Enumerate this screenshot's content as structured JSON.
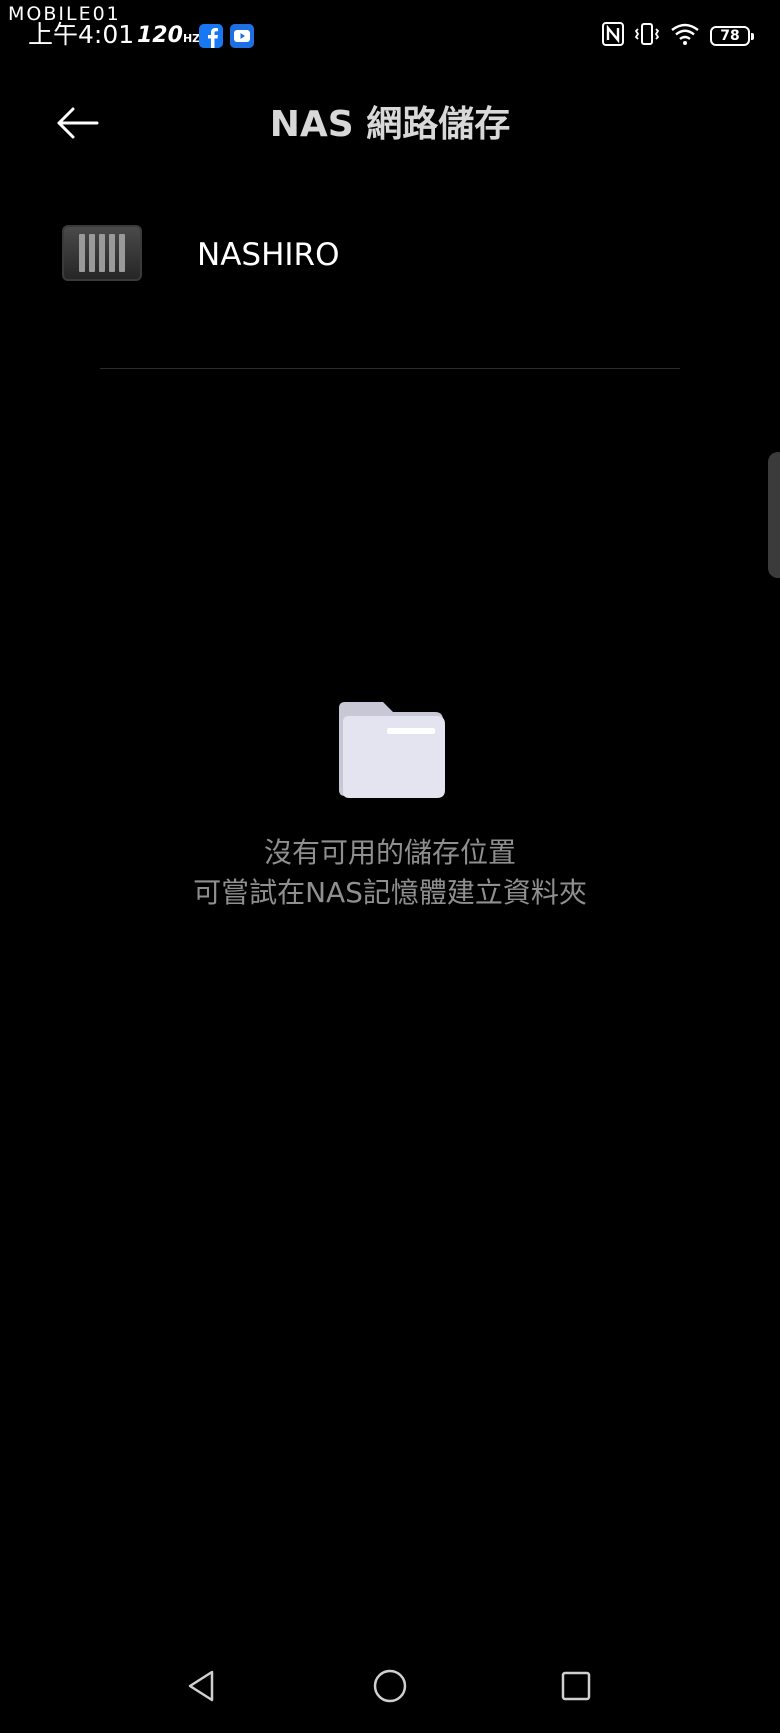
{
  "watermark": "MOBILE01",
  "status_bar": {
    "time": "上午4:01",
    "refresh_rate": "120",
    "refresh_unit": "HZ",
    "battery": "78",
    "colors": {
      "facebook": "#1877f2",
      "youtube": "#1e6fe3"
    }
  },
  "header": {
    "title": "NAS 網路儲存"
  },
  "device": {
    "name": "NASHIRO"
  },
  "empty_state": {
    "line1": "沒有可用的儲存位置",
    "line2": "可嘗試在NAS記憶體建立資料夾"
  },
  "icons": {
    "back": "arrow-left-icon",
    "nas": "nas-drive-icon",
    "folder": "folder-icon",
    "nav_back": "triangle-back-icon",
    "nav_home": "circle-home-icon",
    "nav_recents": "square-recents-icon"
  }
}
